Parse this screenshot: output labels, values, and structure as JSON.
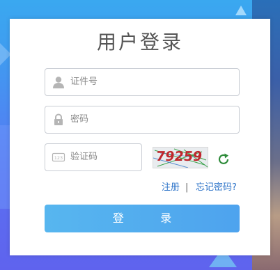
{
  "title": "用户登录",
  "fields": {
    "id": {
      "placeholder": "证件号",
      "icon": "user-icon"
    },
    "password": {
      "placeholder": "密码",
      "icon": "lock-icon"
    },
    "captcha": {
      "placeholder": "验证码",
      "icon": "keyboard-icon"
    }
  },
  "captcha_image": {
    "text": "79259",
    "color": "#c0272d"
  },
  "refresh_icon": "refresh-icon",
  "links": {
    "register": "注册",
    "separator": "|",
    "forgot": "忘记密码?"
  },
  "login_button": "登 录",
  "colors": {
    "primary": "#4ea3ee",
    "link": "#2e74c9",
    "refresh": "#2e8b3a"
  }
}
